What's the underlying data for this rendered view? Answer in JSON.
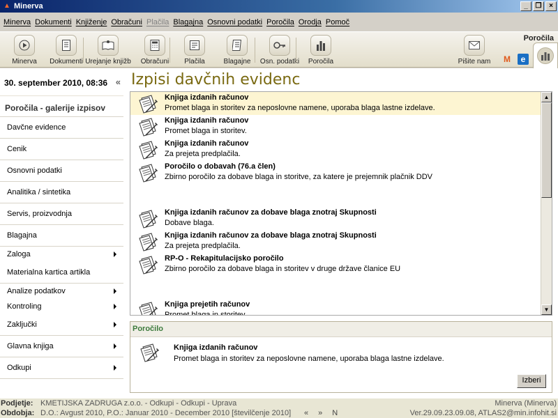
{
  "window": {
    "title": "Minerva"
  },
  "menu": [
    "Minerva",
    "Dokumenti",
    "Knjiženje",
    "Obračuni",
    "Plačila",
    "Blagajna",
    "Osnovni podatki",
    "Poročila",
    "Orodja",
    "Pomoč"
  ],
  "menu_disabled_index": 4,
  "toolbar": {
    "items": [
      "Minerva",
      "Dokumenti",
      "Urejanje knjižb",
      "Obračuni",
      "Plačila",
      "Blagajne",
      "Osn. podatki",
      "Poročila"
    ],
    "mail_label": "Pišite nam",
    "section_label": "Poročila"
  },
  "sidebar": {
    "datetime": "30. september 2010, 08:36",
    "collapse": "«",
    "section_title": "Poročila - galerije izpisov",
    "items": [
      {
        "label": "Davčne evidence",
        "submenu": false
      },
      {
        "label": "Cenik",
        "submenu": false
      },
      {
        "label": "Osnovni podatki",
        "submenu": false
      },
      {
        "label": "Analitika / sintetika",
        "submenu": false
      },
      {
        "label": "Servis, proizvodnja",
        "submenu": false
      },
      {
        "label": "Blagajna",
        "submenu": false
      },
      {
        "label": "Zaloga",
        "submenu": true
      },
      {
        "label": "Materialna kartica artikla",
        "submenu": false
      },
      {
        "label": "Analize podatkov",
        "submenu": true
      },
      {
        "label": "Kontroling",
        "submenu": true
      },
      {
        "label": "Zaključki",
        "submenu": true
      },
      {
        "label": "Glavna knjiga",
        "submenu": true
      },
      {
        "label": "Odkupi",
        "submenu": true
      }
    ]
  },
  "main": {
    "heading": "Izpisi davčnih evidenc",
    "reports": [
      {
        "title": "Knjiga izdanih računov",
        "desc": "Promet blaga in storitev za neposlovne namene, uporaba blaga lastne izdelave.",
        "selected": true
      },
      {
        "title": "Knjiga izdanih računov",
        "desc": "Promet blaga in storitev.",
        "selected": false
      },
      {
        "title": "Knjiga izdanih računov",
        "desc": "Za prejeta predplačila.",
        "selected": false
      },
      {
        "title": "Poročilo o dobavah (76.a člen)",
        "desc": "Zbirno poročilo za dobave blaga in storitve, za katere je prejemnik plačnik DDV",
        "selected": false
      },
      {
        "title": "Knjiga izdanih računov za dobave blaga znotraj Skupnosti",
        "desc": "Dobave blaga.",
        "selected": false
      },
      {
        "title": "Knjiga izdanih računov za dobave blaga znotraj Skupnosti",
        "desc": "Za prejeta predplačila.",
        "selected": false
      },
      {
        "title": "RP-O - Rekapitulacijsko poročilo",
        "desc": "Zbirno poročilo za dobave blaga in storitev v druge države članice EU",
        "selected": false
      },
      {
        "title": "Knjiga prejetih računov",
        "desc": "Promet blaga in storitev",
        "selected": false
      }
    ],
    "detail": {
      "header": "Poročilo",
      "title": "Knjiga izdanih računov",
      "desc": "Promet blaga in storitev za neposlovne namene, uporaba blaga lastne izdelave.",
      "button": "Izberi"
    }
  },
  "status": {
    "company_label": "Podjetje:",
    "company_value": "KMETIJSKA ZADRUGA z.o.o. - Odkupi - Odkupi - Uprava",
    "period_label": "Obdobja:",
    "period_value": "D.O.: Avgust 2010, P.O.: Januar 2010 - December 2010 [številčenje 2010]",
    "nav": [
      "«",
      "»",
      "N"
    ],
    "app_info": "Minerva (Minerva)",
    "version_info": "Ver.29.09.23.09.08, ATLAS2@min.infohit.si"
  },
  "colors": {
    "accent_heading": "#7a6a12",
    "selected_row": "#fdf5d2",
    "detail_header": "#3c7a3c",
    "title_bar": "#0a246a"
  }
}
